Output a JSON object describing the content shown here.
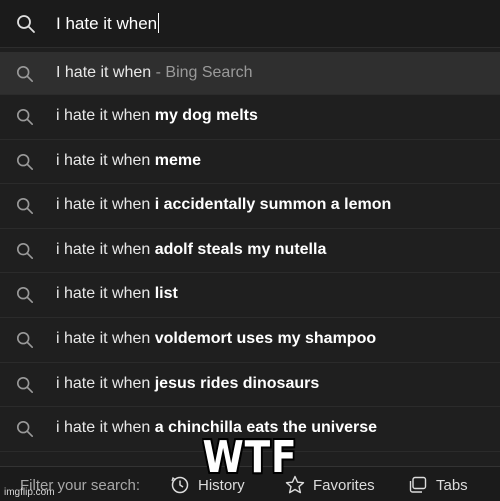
{
  "search": {
    "query": "I hate it when",
    "icon": "search-icon"
  },
  "suggestions": [
    {
      "prefix": "I hate it when",
      "bold": "",
      "suffix": " - Bing Search",
      "icon": "search-icon"
    },
    {
      "prefix": "i hate it when ",
      "bold": "my dog melts",
      "suffix": "",
      "icon": "search-icon"
    },
    {
      "prefix": "i hate it when ",
      "bold": "meme",
      "suffix": "",
      "icon": "search-icon"
    },
    {
      "prefix": "i hate it when ",
      "bold": "i accidentally summon a lemon",
      "suffix": "",
      "icon": "search-icon"
    },
    {
      "prefix": "i hate it when ",
      "bold": "adolf steals my nutella",
      "suffix": "",
      "icon": "search-icon"
    },
    {
      "prefix": "i hate it when ",
      "bold": "list",
      "suffix": "",
      "icon": "search-icon"
    },
    {
      "prefix": "i hate it when ",
      "bold": "voldemort uses my shampoo",
      "suffix": "",
      "icon": "search-icon"
    },
    {
      "prefix": "i hate it when ",
      "bold": "jesus rides dinosaurs",
      "suffix": "",
      "icon": "search-icon"
    },
    {
      "prefix": "i hate it when ",
      "bold": "a chinchilla eats the universe",
      "suffix": "",
      "icon": "search-icon"
    }
  ],
  "footer": {
    "filter_label": "Filter your search:",
    "history_label": "History",
    "favorites_label": "Favorites",
    "tabs_label": "Tabs",
    "history_icon": "history-icon",
    "favorites_icon": "star-icon",
    "tabs_icon": "tabs-icon"
  },
  "caption": "WTF",
  "watermark": "imgflip.com",
  "colors": {
    "background": "#1f1f1f",
    "highlight_row": "#2f2f2f",
    "muted_text": "#9a9a9a"
  }
}
